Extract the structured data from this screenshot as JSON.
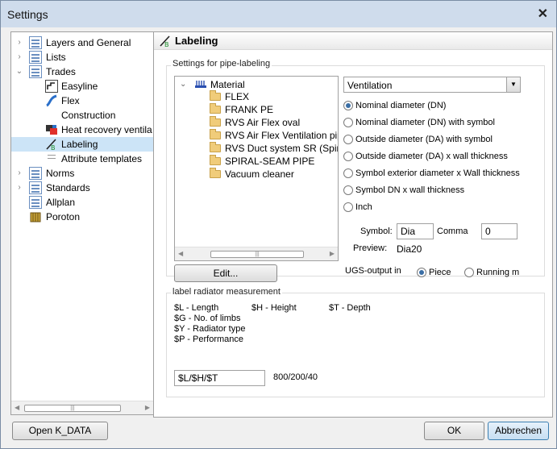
{
  "window": {
    "title": "Settings",
    "close_glyph": "✕"
  },
  "tree": {
    "items": [
      {
        "label": "Layers and General",
        "arrow": "›",
        "icon": "doc-icon"
      },
      {
        "label": "Lists",
        "arrow": "›",
        "icon": "doc-icon"
      },
      {
        "label": "Trades",
        "arrow": "⌄",
        "icon": "doc-icon"
      },
      {
        "label": "Easyline",
        "icon": "easyline-icon"
      },
      {
        "label": "Flex",
        "icon": "flex-icon"
      },
      {
        "label": "Construction",
        "icon": "construction-icon"
      },
      {
        "label": "Heat recovery ventila",
        "icon": "heat-recovery-icon"
      },
      {
        "label": "Labeling",
        "icon": "labeling-icon"
      },
      {
        "label": "Attribute templates",
        "icon": "attribute-icon"
      },
      {
        "label": "Norms",
        "arrow": "›",
        "icon": "doc-icon"
      },
      {
        "label": "Standards",
        "arrow": "›",
        "icon": "doc-icon"
      },
      {
        "label": "Allplan",
        "icon": "doc-icon"
      },
      {
        "label": "Poroton",
        "icon": "poroton-icon"
      }
    ],
    "scroll_grip": "|||",
    "scroll_left": "◀",
    "scroll_right": "▶"
  },
  "panel": {
    "title": "Labeling",
    "pipe_group_label": "Settings for pipe-labeling",
    "material_root": "Material",
    "materials": [
      "FLEX",
      "FRANK PE",
      "RVS Air Flex oval",
      "RVS Air Flex Ventilation pipe",
      "RVS Duct system SR (Spiral s",
      "SPIRAL-SEAM PIPE",
      "Vacuum cleaner"
    ],
    "edit_button": "Edit...",
    "combo_value": "Ventilation",
    "combo_arrow": "▼",
    "radio_options": [
      {
        "label": "Nominal diameter (DN)",
        "checked": true
      },
      {
        "label": "Nominal diameter (DN) with symbol",
        "checked": false
      },
      {
        "label": "Outside diameter (DA) with symbol",
        "checked": false
      },
      {
        "label": "Outside diameter (DA) x wall thickness",
        "checked": false
      },
      {
        "label": "Symbol exterior diameter x Wall thickness",
        "checked": false
      },
      {
        "label": "Symbol DN x wall thickness",
        "checked": false
      },
      {
        "label": "Inch",
        "checked": false
      }
    ],
    "symbol_label": "Symbol:",
    "symbol_value": "Dia",
    "comma_label": "Comma",
    "comma_value": "0",
    "preview_label": "Preview:",
    "preview_value": "Dia20",
    "ugs_label": "UGS-output in",
    "ugs_piece": "Piece",
    "ugs_running": "Running m",
    "ugs_selected": "piece",
    "radiator_group_label": "label radiator measurement",
    "radiator_lines": {
      "l": "$L - Length",
      "h": "$H - Height",
      "t": "$T - Depth",
      "g": "$G - No. of limbs",
      "y": "$Y - Radiator type",
      "p": "$P - Performance"
    },
    "radiator_input": "$L/$H/$T",
    "radiator_result": "800/200/40"
  },
  "footer": {
    "open_kdata": "Open K_DATA",
    "ok": "OK",
    "cancel": "Abbrechen"
  }
}
